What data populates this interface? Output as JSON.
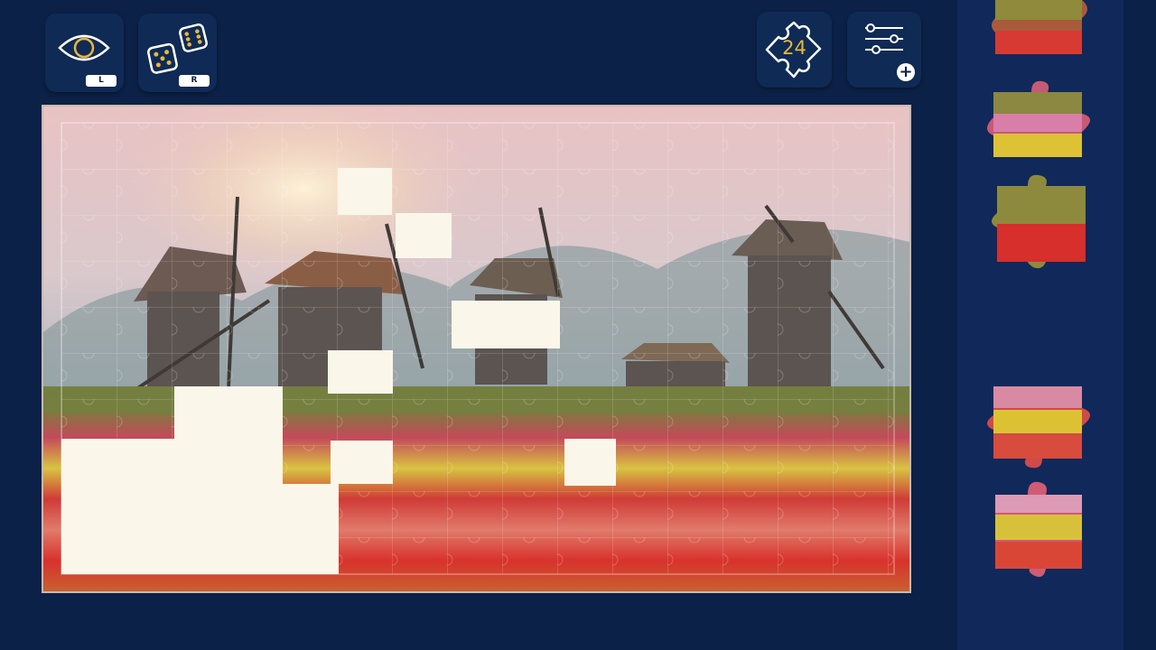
{
  "toolbar": {
    "preview": {
      "icon": "eye-icon",
      "key": "L"
    },
    "shuffle": {
      "icon": "dice-icon",
      "key": "R"
    },
    "piece_count": {
      "icon": "puzzle-piece-icon",
      "value": "24"
    },
    "settings": {
      "icon": "sliders-icon",
      "badge_icon": "plus-icon",
      "badge": "+"
    }
  },
  "colors": {
    "background": "#0c2147",
    "button": "#0f2a55",
    "tray": "#10295a",
    "accent": "#e8b63d"
  }
}
